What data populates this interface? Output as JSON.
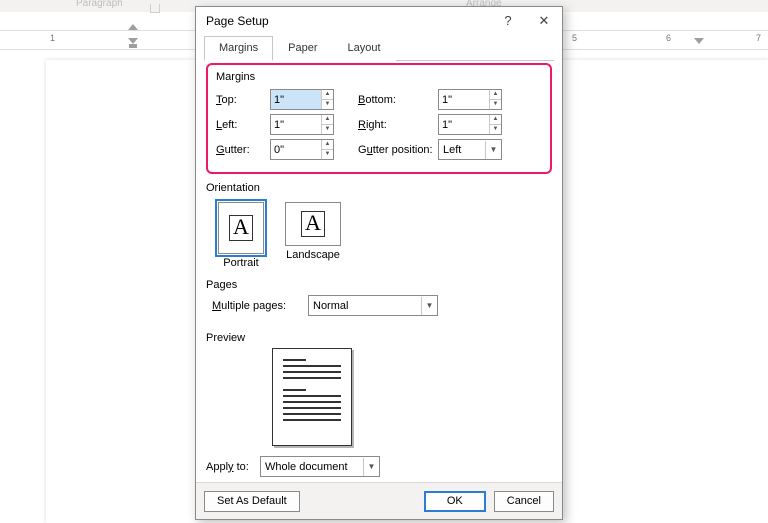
{
  "ribbon_bg_labels": {
    "paragraph": "Paragraph",
    "arrange": "Arrange"
  },
  "ruler": {
    "ticks": [
      "1",
      "5",
      "6",
      "7"
    ],
    "tick_x": [
      50,
      572,
      666,
      760
    ]
  },
  "dialog": {
    "title": "Page Setup",
    "help_symbol": "?",
    "close_symbol": "✕",
    "tabs": [
      "Margins",
      "Paper",
      "Layout"
    ],
    "active_tab": 0,
    "margins": {
      "group_label": "Margins",
      "labels": {
        "top": "Top:",
        "bottom": "Bottom:",
        "left": "Left:",
        "right": "Right:",
        "gutter": "Gutter:",
        "gutter_pos": "Gutter position:"
      },
      "underline_idx": {
        "top": 0,
        "bottom": 0,
        "left": 0,
        "right": 0,
        "gutter": 0,
        "gutter_pos": 1
      },
      "values": {
        "top": "1\"",
        "bottom": "1\"",
        "left": "1\"",
        "right": "1\"",
        "gutter": "0\"",
        "gutter_pos": "Left"
      }
    },
    "orientation": {
      "group_label": "Orientation",
      "portrait": "Portrait",
      "landscape": "Landscape",
      "selected": "portrait",
      "glyph": "A"
    },
    "pages": {
      "group_label": "Pages",
      "label": "Multiple pages:",
      "underline_idx": 0,
      "value": "Normal"
    },
    "preview": {
      "group_label": "Preview"
    },
    "apply_to": {
      "label": "Apply to:",
      "underline_idx": 6,
      "value": "Whole document"
    },
    "footer": {
      "set_default": "Set As Default",
      "default_ul": 7,
      "ok": "OK",
      "cancel": "Cancel"
    }
  }
}
